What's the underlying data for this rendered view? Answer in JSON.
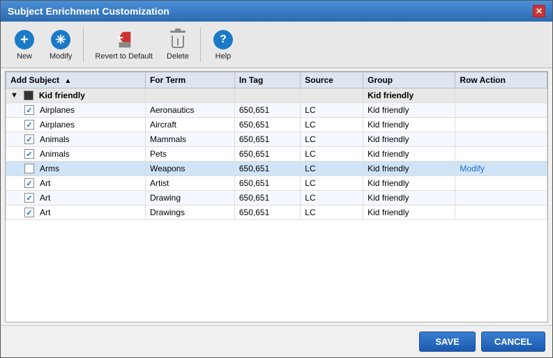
{
  "dialog": {
    "title": "Subject Enrichment Customization",
    "close_label": "✕"
  },
  "toolbar": {
    "new_label": "New",
    "modify_label": "Modify",
    "revert_label": "Revert to Default",
    "delete_label": "Delete",
    "help_label": "Help"
  },
  "table": {
    "columns": [
      {
        "id": "add_subject",
        "label": "Add Subject"
      },
      {
        "id": "for_term",
        "label": "For Term"
      },
      {
        "id": "in_tag",
        "label": "In Tag"
      },
      {
        "id": "source",
        "label": "Source"
      },
      {
        "id": "group",
        "label": "Group"
      },
      {
        "id": "row_action",
        "label": "Row Action"
      }
    ],
    "rows": [
      {
        "type": "group",
        "add_subject": "Kid friendly",
        "for_term": "",
        "in_tag": "",
        "source": "",
        "group": "Kid friendly",
        "row_action": "",
        "checked": true,
        "expanded": true
      },
      {
        "type": "item",
        "add_subject": "Airplanes",
        "for_term": "Aeronautics",
        "in_tag": "650,651",
        "source": "LC",
        "group": "Kid friendly",
        "row_action": "",
        "checked": true
      },
      {
        "type": "item",
        "add_subject": "Airplanes",
        "for_term": "Aircraft",
        "in_tag": "650,651",
        "source": "LC",
        "group": "Kid friendly",
        "row_action": "",
        "checked": true
      },
      {
        "type": "item",
        "add_subject": "Animals",
        "for_term": "Mammals",
        "in_tag": "650,651",
        "source": "LC",
        "group": "Kid friendly",
        "row_action": "",
        "checked": true
      },
      {
        "type": "item",
        "add_subject": "Animals",
        "for_term": "Pets",
        "in_tag": "650,651",
        "source": "LC",
        "group": "Kid friendly",
        "row_action": "",
        "checked": true
      },
      {
        "type": "item",
        "add_subject": "Arms",
        "for_term": "Weapons",
        "in_tag": "650,651",
        "source": "LC",
        "group": "Kid friendly",
        "row_action": "Modify",
        "checked": false,
        "highlighted": true
      },
      {
        "type": "item",
        "add_subject": "Art",
        "for_term": "Artist",
        "in_tag": "650,651",
        "source": "LC",
        "group": "Kid friendly",
        "row_action": "",
        "checked": true
      },
      {
        "type": "item",
        "add_subject": "Art",
        "for_term": "Drawing",
        "in_tag": "650,651",
        "source": "LC",
        "group": "Kid friendly",
        "row_action": "",
        "checked": true
      },
      {
        "type": "item",
        "add_subject": "Art",
        "for_term": "Drawings",
        "in_tag": "650,651",
        "source": "LC",
        "group": "Kid friendly",
        "row_action": "",
        "checked": true
      }
    ]
  },
  "footer": {
    "save_label": "SAVE",
    "cancel_label": "CANCEL"
  }
}
